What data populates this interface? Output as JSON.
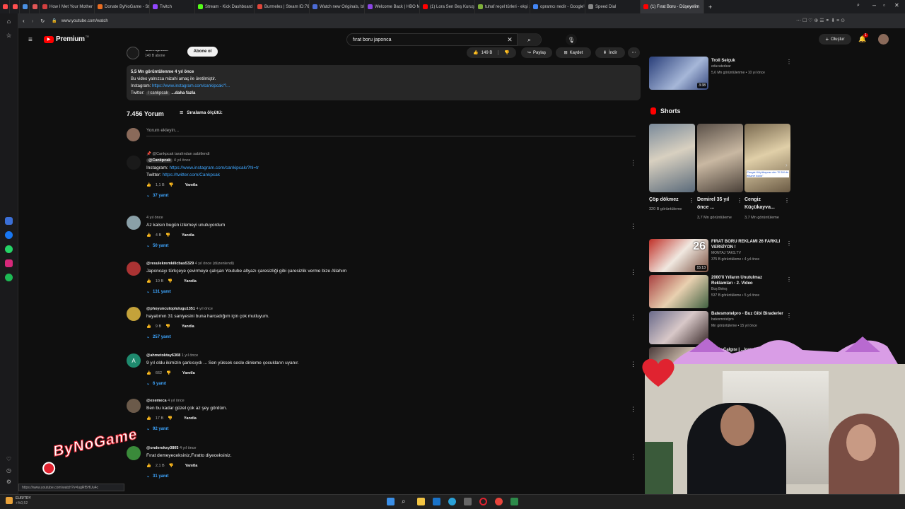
{
  "browser": {
    "tabs": [
      {
        "label": "",
        "color": "#ff4a4a"
      },
      {
        "label": "",
        "color": "#ff5050"
      },
      {
        "label": "",
        "color": "#4a90e2"
      },
      {
        "label": "",
        "color": "#e05656"
      },
      {
        "label": "How I Met Your Mother |",
        "color": "#d23f3f"
      },
      {
        "label": "Donate ByNoGame - Stre",
        "color": "#e96d22"
      },
      {
        "label": "Twitch",
        "color": "#9146ff"
      },
      {
        "label": "Stream - Kick Dashboard",
        "color": "#53fc18"
      },
      {
        "label": "Burmeles | Steam ID:7656",
        "color": "#e0463a"
      },
      {
        "label": "Watch new Originals, blo",
        "color": "#4b6bd6"
      },
      {
        "label": "Welcome Back | HBO Max",
        "color": "#8b45e5"
      },
      {
        "label": "(1) Lora Sen Beş Kuruş Et",
        "color": "#ff0000"
      },
      {
        "label": "tuhaf reçel türleri - ekşi sö",
        "color": "#7fb03a"
      },
      {
        "label": "opramcı nedir - Google'd",
        "color": "#4285f4"
      },
      {
        "label": "Speed Dial",
        "color": "#888888"
      },
      {
        "label": "(1) Fırat Boru - Düşeyelim",
        "color": "#ff0000"
      }
    ],
    "url": "www.youtube.com/watch",
    "status_url": "https://www.youtube.com/watch?v=lugRf5HUu4c"
  },
  "header": {
    "logo_label": "Premium",
    "logo_sup": "TR",
    "search_value": "fırat boru japonca",
    "create_label": "Oluştur",
    "notif_count": "1"
  },
  "video": {
    "channel_name": "Cankpcak",
    "subscribers": "140 B abone",
    "subscribe_label": "Abone ol",
    "likes": "149 B",
    "share_label": "Paylaş",
    "save_label": "Kaydet",
    "download_label": "İndir",
    "desc_stats": "5,5 Mn görüntülenme  4 yıl önce",
    "desc_line1": "Bu video yalnızca mizahi amaç ile üretilmiştir.",
    "desc_ig_label": "Instagram: ",
    "desc_ig_link": "https://www.instagram.com/cankipcak/?...",
    "desc_tw_label": "Twitter: ",
    "desc_tw_handle": "/ cankpcak",
    "desc_more": "...daha fazla"
  },
  "comments_header": {
    "count": "7.456 Yorum",
    "sort_label": "Sıralama ölçütü:",
    "add_placeholder": "Yorum ekleyin..."
  },
  "comments": [
    {
      "pinned": "@Cankpcak tarafından sabitlendi",
      "author": "@Cankpcak",
      "time": "4 yıl önce",
      "lines": [
        "Instagram: ",
        "Twitter: "
      ],
      "links": [
        "https://www.instagram.com/cankipcak/?hl=tr",
        "https://twitter.com/Cankpcak"
      ],
      "likes": "1,1 B",
      "reply": "Yanıtla",
      "replies": "37 yanıt",
      "avatar_color": "#1a1a1a"
    },
    {
      "author": "",
      "time": "4 yıl önce",
      "text": "Az kalsın bugün izlemeyi unutuyordum",
      "likes": "4 B",
      "reply": "Yanıtla",
      "replies": "50 yanıt",
      "avatar_color": "#8aa0a8"
    },
    {
      "author": "@resulekremkilicbas5329",
      "time": "4 yıl önce (düzenlendi)",
      "text": "Japoncayı türkçeye çevirmeye çalışan Youtube altyazı çaresizliği gibi çaresizlik verme bize Allahım",
      "likes": "10 B",
      "reply": "Yanıtla",
      "replies": "131 yanıt",
      "avatar_color": "#a33"
    },
    {
      "author": "@phoyuncutoplulugu1351",
      "time": "4 yıl önce",
      "text": "hayatımın 31 saniyesini buna harcadığım için çok mutluyum.",
      "likes": "9 B",
      "reply": "Yanıtla",
      "replies": "257 yanıt",
      "avatar_color": "#c4a23a"
    },
    {
      "author": "@ahmetoktay6308",
      "time": "1 yıl önce",
      "text": "9 yıl oldu ikimizin şarkısıydı ... Sen yüksek sesle dinleme çocukların uyanır.",
      "likes": "662",
      "reply": "Yanıtla",
      "replies": "6 yanıt",
      "avatar_color": "#1e8a6e",
      "avatar_letter": "A"
    },
    {
      "author": "@exemeca",
      "time": "4 yıl önce",
      "text": "Ben bu kadar güzel çok az şey gördüm.",
      "likes": "17 B",
      "reply": "Yanıtla",
      "replies": "92 yanıt",
      "avatar_color": "#6b5a4a"
    },
    {
      "author": "@onderoksy3805",
      "time": "4 yıl önce",
      "text": "Fırat demeyeceksiniz,Fıratto diyeceksiniz.",
      "likes": "2,1 B",
      "reply": "Yanıtla",
      "replies": "31 yanıt",
      "avatar_color": "#3a8a3a"
    }
  ],
  "sidebar": {
    "top_video": {
      "title": "Troll Selçuk",
      "channel": "educatedear",
      "stats": "5,6 Mn görüntülenme • 10 yıl önce",
      "duration": "3:38"
    },
    "shorts_title": "Shorts",
    "shorts": [
      {
        "title": "Çöp dökmez",
        "views": "320 B görüntüleme"
      },
      {
        "title": "Demirel 35 yıl önce ...",
        "views": "3,7 Mn görüntüleme"
      },
      {
        "title": "Cengiz Küçükayva...",
        "views": "3,7 Mn görüntüleme"
      }
    ],
    "short_caption": "Cengiz Küçükayvaz der \"8 Sül de efsane tokta\"",
    "videos": [
      {
        "title": "FIRAT BORU REKLAMI 26 FARKLI VERSİYON !",
        "channel": "MONTAJ TAKS.TV",
        "stats": "375 B görüntüleme • 4 yıl önce",
        "duration": "15:13",
        "badge": "26"
      },
      {
        "title": "2000'li Yılların Unutulmaz Reklamları - 2. Video",
        "channel": "Boş Beleş",
        "stats": "537 B görüntüleme • 5 yıl önce",
        "duration": ""
      },
      {
        "title": "Batesmotelpro - Buz Gibi Biraderler",
        "channel": "batesmotelpro",
        "stats": "Mn görüntüleme • 15 yıl önce",
        "duration": ""
      },
      {
        "title": "Arefe Çalgısı | ...kusu!",
        "channel": "",
        "stats": "",
        "duration": ""
      }
    ]
  },
  "overlay": {
    "logo_text": "ByNoGame"
  },
  "taskbar": {
    "currency": "EUR/TRY",
    "currency_change": "+%0,52"
  }
}
